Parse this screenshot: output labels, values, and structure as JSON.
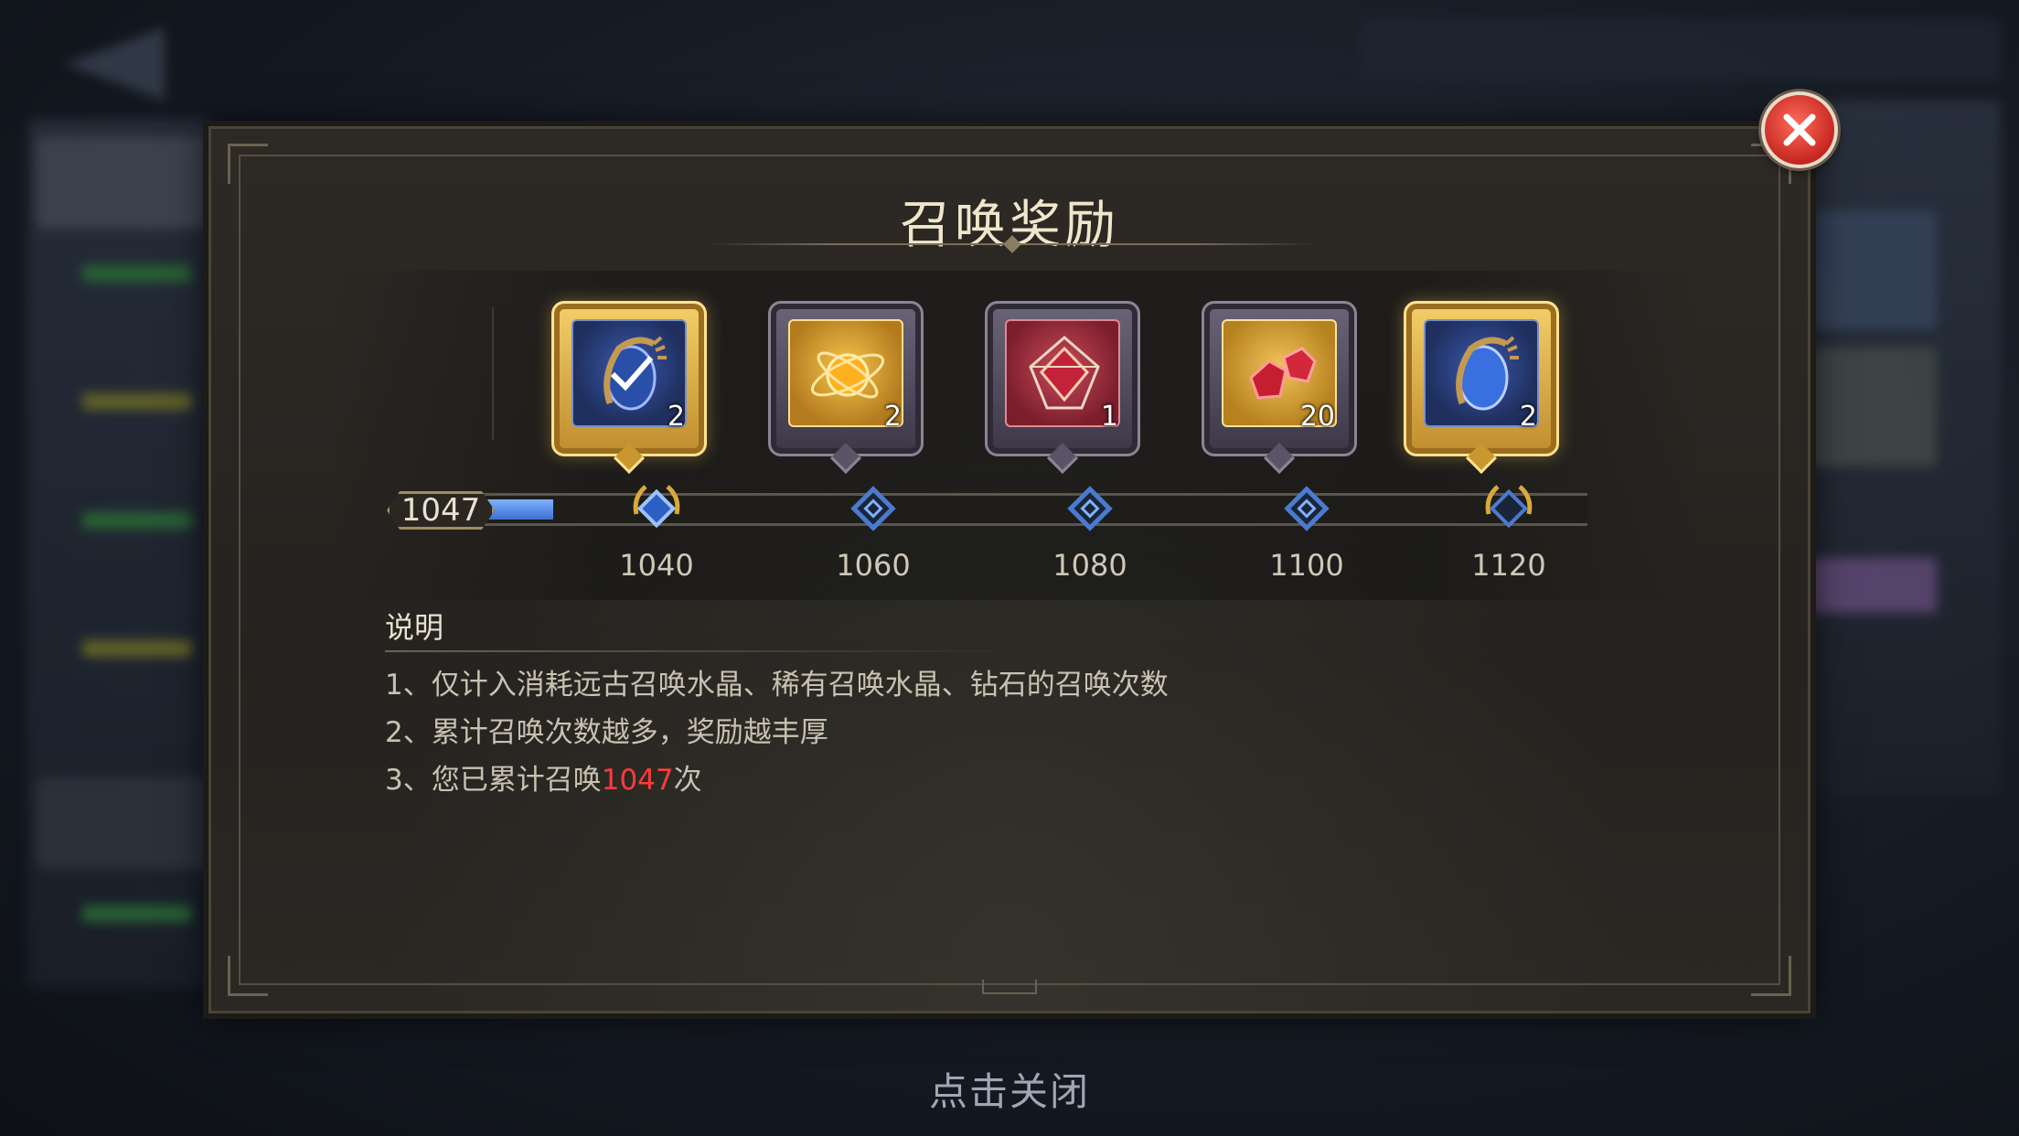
{
  "dialog": {
    "title": "召唤奖励",
    "close_hint": "点击关闭"
  },
  "progress": {
    "current": "1047",
    "fill_fraction": 0.13,
    "milestones": [
      {
        "value": "1040",
        "reward_qty": "2",
        "reward_icon": "blue-crystal-claw-icon",
        "claimed": true,
        "highlight": true
      },
      {
        "value": "1060",
        "reward_qty": "2",
        "reward_icon": "golden-orb-icon",
        "claimed": false,
        "highlight": false
      },
      {
        "value": "1080",
        "reward_qty": "1",
        "reward_icon": "red-geometric-crystal-icon",
        "claimed": false,
        "highlight": false
      },
      {
        "value": "1100",
        "reward_qty": "20",
        "reward_icon": "red-gems-icon",
        "claimed": false,
        "highlight": false
      },
      {
        "value": "1120",
        "reward_qty": "2",
        "reward_icon": "blue-crystal-claw-icon",
        "claimed": false,
        "highlight": true
      }
    ]
  },
  "description": {
    "heading": "说明",
    "line1": "1、仅计入消耗远古召唤水晶、稀有召唤水晶、钻石的召唤次数",
    "line2": "2、累计召唤次数越多，奖励越丰厚",
    "line3_prefix": "3、您已累计召唤",
    "line3_value": "1047",
    "line3_suffix": "次"
  },
  "colors": {
    "accent_gold": "#f3cf6a",
    "progress_blue": "#5a8ef0",
    "highlight_red": "#ff3b3b",
    "close_red": "#d9352b"
  }
}
